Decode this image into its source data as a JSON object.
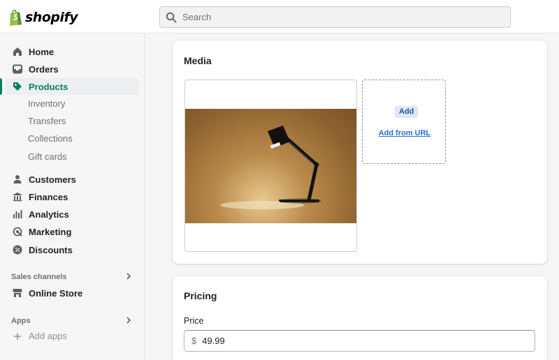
{
  "brand": {
    "name": "shopify"
  },
  "search": {
    "placeholder": "Search"
  },
  "nav": [
    {
      "label": "Home",
      "icon": "home-icon"
    },
    {
      "label": "Orders",
      "icon": "orders-icon"
    },
    {
      "label": "Products",
      "icon": "tag-icon",
      "active": true
    }
  ],
  "products_sub": [
    "Inventory",
    "Transfers",
    "Collections",
    "Gift cards"
  ],
  "nav2": [
    {
      "label": "Customers",
      "icon": "person-icon"
    },
    {
      "label": "Finances",
      "icon": "bank-icon"
    },
    {
      "label": "Analytics",
      "icon": "bar-chart-icon"
    },
    {
      "label": "Marketing",
      "icon": "target-icon"
    },
    {
      "label": "Discounts",
      "icon": "discount-icon"
    }
  ],
  "sales_channels": {
    "heading": "Sales channels",
    "items": [
      {
        "label": "Online Store",
        "icon": "store-icon"
      }
    ]
  },
  "apps": {
    "heading": "Apps",
    "add_label": "Add apps"
  },
  "media": {
    "title": "Media",
    "add_label": "Add",
    "add_url_label": "Add from URL"
  },
  "pricing": {
    "title": "Pricing",
    "price_label": "Price",
    "currency_symbol": "$",
    "price_value": "49.99"
  },
  "colors": {
    "accent": "#008060",
    "link": "#2c6ecb"
  }
}
